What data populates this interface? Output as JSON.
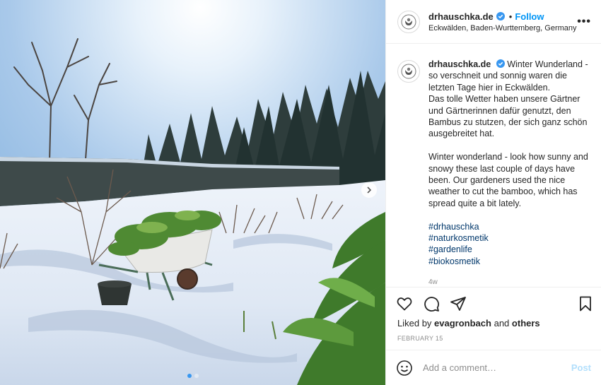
{
  "post": {
    "account": "drhauschka.de",
    "separator": "•",
    "follow_label": "Follow",
    "location": "Eckwälden, Baden-Wurttemberg, Germany",
    "more_glyph": "•••",
    "caption": {
      "username": "drhauschka.de",
      "text_de_1": "Winter Wunderland - so verschneit und sonnig waren die letzten Tage hier in Eckwälden.",
      "text_de_2": "Das tolle Wetter haben unsere Gärtner und Gärtnerinnen dafür genutzt, den Bambus zu stutzen, der sich ganz schön ausgebreitet hat.",
      "text_en": "Winter wonderland - look how sunny and snowy these last couple of days have been. Our gardeners used the nice weather to cut the bamboo, which has spread quite a bit lately.",
      "hashtags": [
        "#drhauschka",
        "#naturkosmetik",
        "#gardenlife",
        "#biokosmetik"
      ],
      "age": "4w"
    },
    "likes": {
      "prefix": "Liked by",
      "user": "evagronbach",
      "joiner": "and",
      "others": "others"
    },
    "date": "FEBRUARY 15",
    "comment": {
      "placeholder": "Add a comment…",
      "post_label": "Post"
    },
    "carousel": {
      "count": 2,
      "active_index": 0
    },
    "colors": {
      "accent": "#0095f6",
      "verified": "#3897f0",
      "link": "#00376b",
      "muted": "#8e8e8e"
    },
    "icons": [
      "verified-icon",
      "more-icon",
      "heart-icon",
      "comment-icon",
      "share-icon",
      "save-icon",
      "emoji-icon",
      "next-arrow-icon"
    ]
  }
}
